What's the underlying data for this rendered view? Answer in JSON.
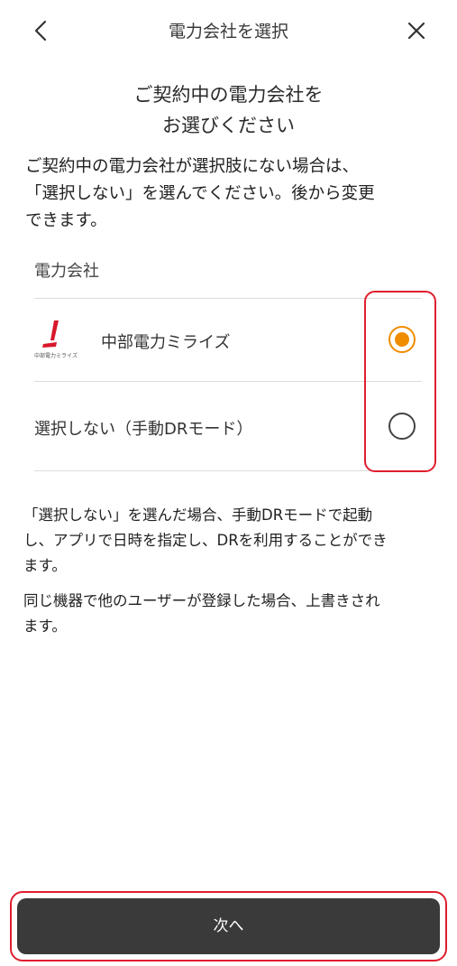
{
  "header": {
    "title": "電力会社を選択",
    "back_icon": "chevron-left-icon",
    "close_icon": "close-icon"
  },
  "heading": {
    "line1": "ご契約中の電力会社を",
    "line2": "お選びください"
  },
  "intro": {
    "line1": "ご契約中の電力会社が選択肢にない場合は、",
    "line2": "「選択しない」を選んでください。後から変更",
    "line3": "できます。"
  },
  "section_label": "電力会社",
  "options": [
    {
      "label": "中部電力ミライズ",
      "logo_caption": "中部電力ミライズ",
      "selected": true
    },
    {
      "label": "選択しない（手動DRモード）",
      "selected": false
    }
  ],
  "note1": {
    "line1": "「選択しない」を選んだ場合、手動DRモードで起動",
    "line2": "し、アプリで日時を指定し、DRを利用することができ",
    "line3": "ます。"
  },
  "note2": {
    "line1": "同じ機器で他のユーザーが登録した場合、上書きされ",
    "line2": "ます。"
  },
  "next_label": "次へ",
  "colors": {
    "accent": "#f08c00",
    "highlight": "#e01e2e",
    "button_bg": "#3a3a3a",
    "logo_red": "#d7182a"
  }
}
